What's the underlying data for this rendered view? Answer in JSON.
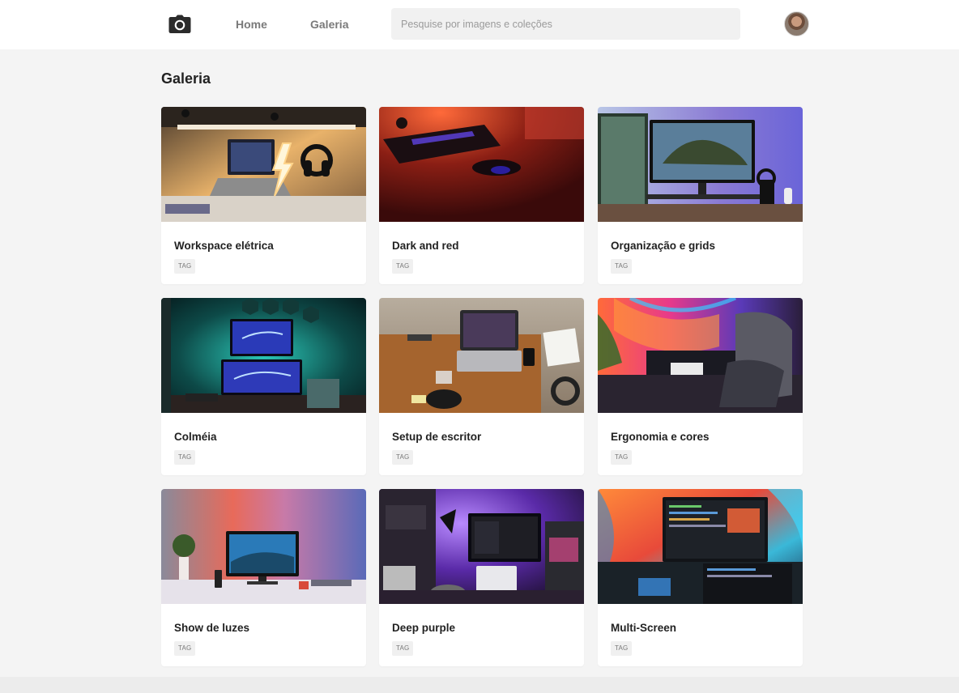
{
  "nav": {
    "logo_icon": "camera-icon",
    "home_label": "Home",
    "gallery_label": "Galeria",
    "search_placeholder": "Pesquise por imagens e coleções",
    "avatar_icon": "user-avatar"
  },
  "page": {
    "title": "Galeria"
  },
  "cards": [
    {
      "title": "Workspace elétrica",
      "tag": "TAG"
    },
    {
      "title": "Dark and red",
      "tag": "TAG"
    },
    {
      "title": "Organização e grids",
      "tag": "TAG"
    },
    {
      "title": "Colméia",
      "tag": "TAG"
    },
    {
      "title": "Setup de escritor",
      "tag": "TAG"
    },
    {
      "title": "Ergonomia e cores",
      "tag": "TAG"
    },
    {
      "title": "Show de luzes",
      "tag": "TAG"
    },
    {
      "title": "Deep purple",
      "tag": "TAG"
    },
    {
      "title": "Multi-Screen",
      "tag": "TAG"
    }
  ],
  "colors": {
    "background": "#f4f4f4",
    "topbar": "#ffffff",
    "card": "#ffffff",
    "nav_text": "#7a7a7a",
    "title_text": "#222222"
  }
}
